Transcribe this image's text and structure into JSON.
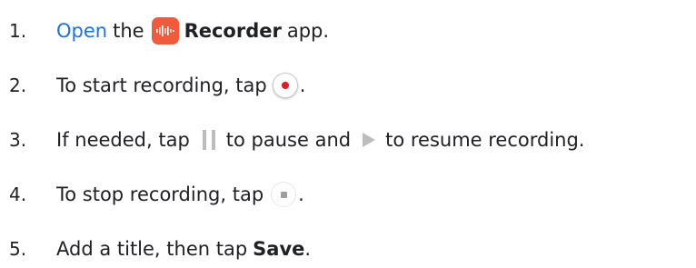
{
  "steps": [
    {
      "number": "1.",
      "link": "Open",
      "text_a": "the",
      "app_name": "Recorder",
      "text_b": "app.",
      "icon": "recorder-app-icon"
    },
    {
      "number": "2.",
      "text_a": "To start recording, tap",
      "text_b": ".",
      "icon": "record-button-icon"
    },
    {
      "number": "3.",
      "text_a": "If needed, tap",
      "text_b": "to pause and",
      "text_c": "to resume recording.",
      "icons": [
        "pause-icon",
        "play-icon"
      ]
    },
    {
      "number": "4.",
      "text_a": "To stop recording, tap",
      "text_b": ".",
      "icon": "stop-button-icon"
    },
    {
      "number": "5.",
      "text_a": "Add a title, then tap",
      "bold": "Save",
      "text_b": "."
    }
  ],
  "colors": {
    "link": "#1a73e8",
    "app_icon": "#f25a3c",
    "record_dot": "#e01b24",
    "control_gray": "#bdbdbd"
  }
}
